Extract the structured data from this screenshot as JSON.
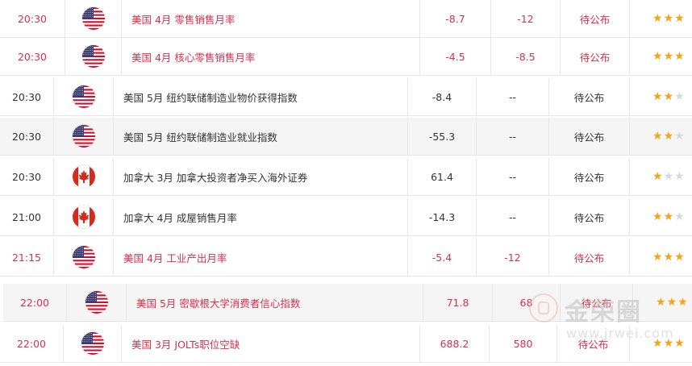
{
  "events": [
    {
      "time": "20:30",
      "flag": "us",
      "event": "美国 4月 零售销售月率",
      "previous": "-8.7",
      "forecast": "-12",
      "status": "待公布",
      "stars": 3,
      "highlight": true
    },
    {
      "time": "20:30",
      "flag": "us",
      "event": "美国 4月 核心零售销售月率",
      "previous": "-4.5",
      "forecast": "-8.5",
      "status": "待公布",
      "stars": 3,
      "highlight": true
    },
    {
      "time": "20:30",
      "flag": "us",
      "event": "美国 5月 纽约联储制造业物价获得指数",
      "previous": "-8.4",
      "forecast": "--",
      "status": "待公布",
      "stars": 2,
      "highlight": false
    },
    {
      "time": "20:30",
      "flag": "us",
      "event": "美国 5月 纽约联储制造业就业指数",
      "previous": "-55.3",
      "forecast": "--",
      "status": "待公布",
      "stars": 2,
      "highlight": false
    },
    {
      "time": "20:30",
      "flag": "ca",
      "event": "加拿大 3月 加拿大投资者净买入海外证券",
      "previous": "61.4",
      "forecast": "--",
      "status": "待公布",
      "stars": 1,
      "highlight": false
    },
    {
      "time": "21:00",
      "flag": "ca",
      "event": "加拿大 4月 成屋销售月率",
      "previous": "-14.3",
      "forecast": "--",
      "status": "待公布",
      "stars": 2,
      "highlight": false
    },
    {
      "time": "21:15",
      "flag": "us",
      "event": "美国 4月 工业产出月率",
      "previous": "-5.4",
      "forecast": "-12",
      "status": "待公布",
      "stars": 3,
      "highlight": true
    },
    {
      "time": "22:00",
      "flag": "us",
      "event": "美国 5月 密歇根大学消费者信心指数",
      "previous": "71.8",
      "forecast": "68",
      "status": "待公布",
      "stars": 3,
      "highlight": true
    },
    {
      "time": "22:00",
      "flag": "us",
      "event": "美国 3月 JOLTs职位空缺",
      "previous": "688.2",
      "forecast": "580",
      "status": "待公布",
      "stars": 3,
      "highlight": true
    }
  ],
  "watermark": {
    "name": "金荣圈",
    "url": "www.jrwei.com"
  },
  "colors": {
    "highlight": "#d6314d",
    "star": "#f5a31a",
    "star_off": "#d9d9d9"
  }
}
